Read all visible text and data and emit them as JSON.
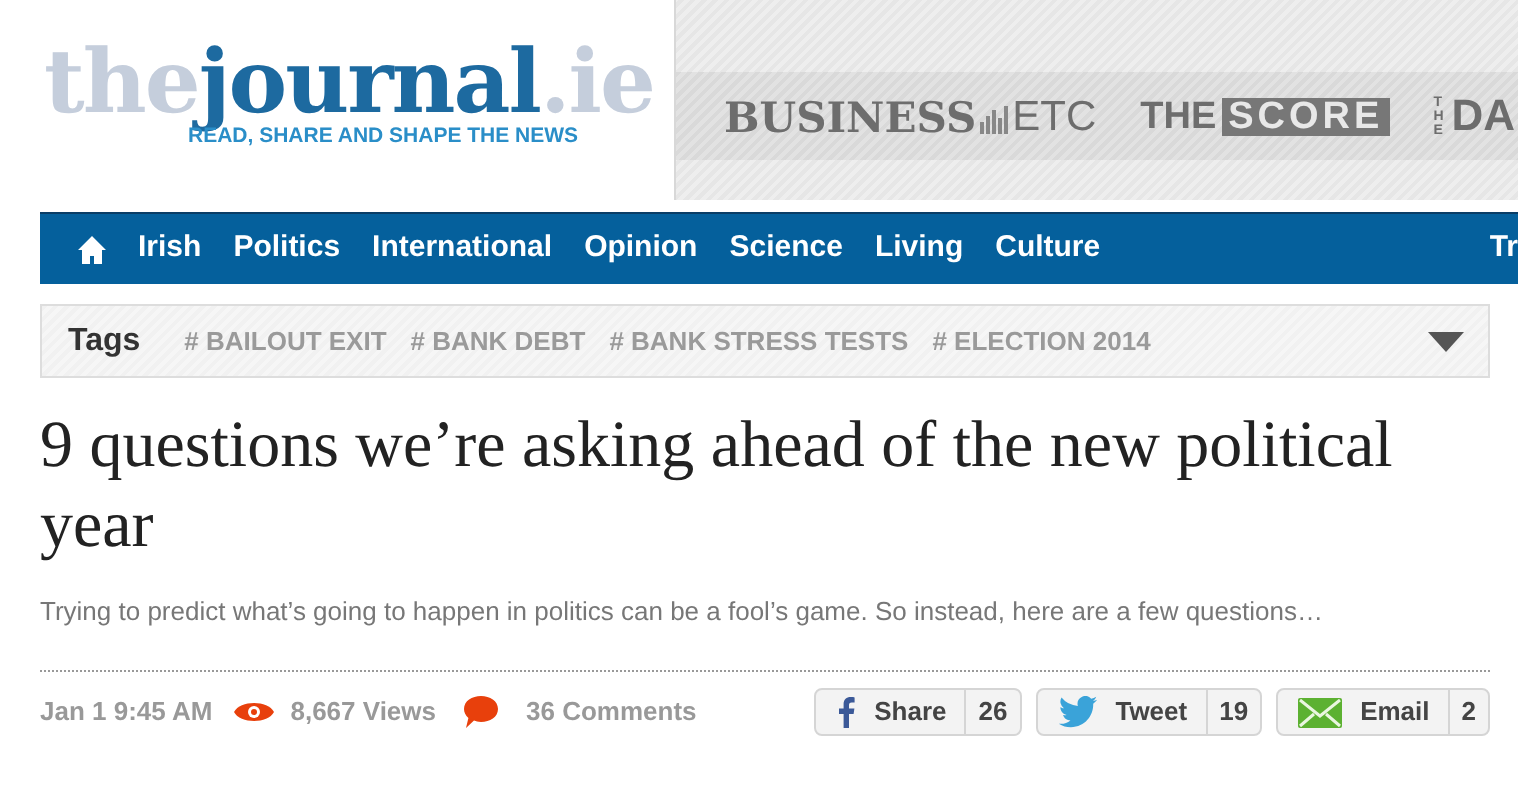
{
  "logo": {
    "prefix": "the",
    "name": "journal",
    "suffix": ".ie",
    "tagline": "READ, SHARE AND SHAPE THE NEWS"
  },
  "network_sites": [
    {
      "kind": "business",
      "main": "BUSINESS",
      "sub": "ETC"
    },
    {
      "kind": "score",
      "main": "THE",
      "sub": "SCORE"
    },
    {
      "kind": "daily",
      "main": "THE",
      "sub": "DA"
    }
  ],
  "nav": {
    "items": [
      "Irish",
      "Politics",
      "International",
      "Opinion",
      "Science",
      "Living",
      "Culture"
    ],
    "overflow": "Tr"
  },
  "tags": {
    "label": "Tags",
    "items": [
      "# BAILOUT EXIT",
      "# BANK DEBT",
      "# BANK STRESS TESTS",
      "# ELECTION 2014"
    ]
  },
  "article": {
    "title": "9 questions we’re asking ahead of the new political year",
    "summary": "Trying to predict what’s going to happen in politics can be a fool’s game. So instead, here are a few questions…",
    "date": "Jan 1 9:45 AM",
    "views": "8,667 Views",
    "comments": "36 Comments",
    "shares": [
      {
        "kind": "facebook",
        "label": "Share",
        "count": "26"
      },
      {
        "kind": "twitter",
        "label": "Tweet",
        "count": "19"
      },
      {
        "kind": "email",
        "label": "Email",
        "count": "2"
      }
    ]
  }
}
